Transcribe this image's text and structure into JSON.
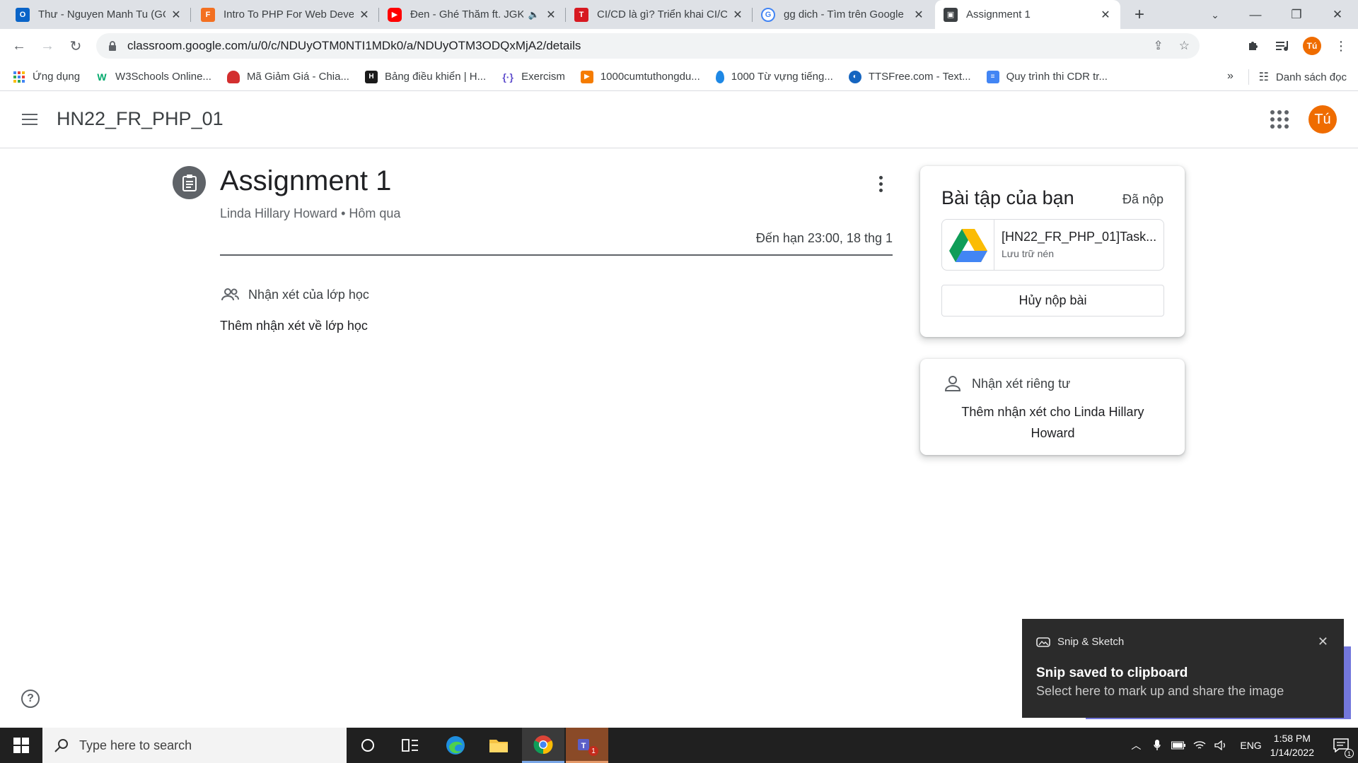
{
  "browser": {
    "tabs": [
      {
        "title": "Thư - Nguyen Manh Tu (GO",
        "icon": "outlook-icon",
        "color": "#0a64c8"
      },
      {
        "title": "Intro To PHP For Web Deve",
        "icon": "fpt-icon",
        "color": "#f37021"
      },
      {
        "title": "Đen - Ghé Thăm ft. JGK",
        "icon": "youtube-icon",
        "color": "#ff0000"
      },
      {
        "title": "CI/CD là gì? Triển khai CI/CD",
        "icon": "t-icon",
        "color": "#d71921"
      },
      {
        "title": "gg dich - Tìm trên Google",
        "icon": "google-icon",
        "color": "#4285f4"
      },
      {
        "title": "Assignment 1",
        "icon": "classroom-icon",
        "color": "#188038"
      }
    ],
    "url": "classroom.google.com/u/0/c/NDUyOTM0NTI1MDk0/a/NDUyOTM3ODQxMjA2/details",
    "profile_initial": "Tú",
    "bookmarks": [
      {
        "label": "Ứng dụng",
        "icon": "apps-grid-icon",
        "color": "#4285f4"
      },
      {
        "label": "W3Schools Online...",
        "icon": "w3schools-icon",
        "color": "#04aa6d"
      },
      {
        "label": "Mã Giảm Giá - Chia...",
        "icon": "coupon-icon",
        "color": "#d32f2f"
      },
      {
        "label": "Bảng điều khiển | H...",
        "icon": "hackerrank-icon",
        "color": "#1a1a1a"
      },
      {
        "label": "Exercism",
        "icon": "exercism-icon",
        "color": "#604fcd"
      },
      {
        "label": "1000cumtuthongdu...",
        "icon": "play-icon",
        "color": "#f57c00"
      },
      {
        "label": "1000 Từ vựng tiếng...",
        "icon": "drop-icon",
        "color": "#1e88e5"
      },
      {
        "label": "TTSFree.com - Text...",
        "icon": "ttsfree-icon",
        "color": "#1565c0"
      },
      {
        "label": "Quy trình thi CDR tr...",
        "icon": "docs-icon",
        "color": "#4285f4"
      }
    ],
    "more_bookmarks": "»",
    "reading_list": "Danh sách đọc"
  },
  "classroom": {
    "class_name": "HN22_FR_PHP_01",
    "user_initial": "Tú",
    "assignment": {
      "title": "Assignment 1",
      "meta": "Linda Hillary Howard • Hôm qua",
      "due": "Đến hạn 23:00, 18 thg 1",
      "class_comments_label": "Nhận xét của lớp học",
      "add_class_comment": "Thêm nhận xét về lớp học"
    },
    "your_work": {
      "heading": "Bài tập của bạn",
      "status": "Đã nộp",
      "attachment_name": "[HN22_FR_PHP_01]Task...",
      "attachment_type": "Lưu trữ nén",
      "unsubmit_label": "Hủy nộp bài"
    },
    "private_comments": {
      "heading": "Nhận xét riêng tư",
      "add": "Thêm nhận xét cho Linda Hillary Howard"
    }
  },
  "toast": {
    "app": "Snip & Sketch",
    "title": "Snip saved to clipboard",
    "body": "Select here to mark up and share the image"
  },
  "taskbar": {
    "search_placeholder": "Type here to search",
    "language": "ENG",
    "time": "1:58 PM",
    "date": "1/14/2022",
    "teams_badge": "1",
    "notification_count": "1"
  }
}
